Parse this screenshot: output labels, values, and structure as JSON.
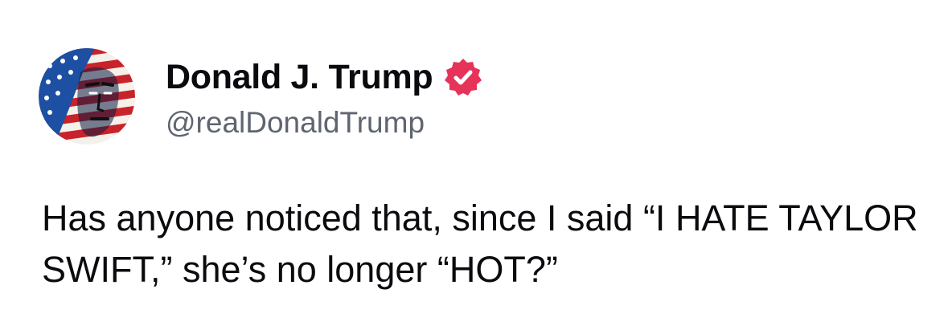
{
  "post": {
    "author": {
      "display_name": "Donald J. Trump",
      "handle": "@realDonaldTrump",
      "verified": true,
      "avatar_icon": "flag-portrait-avatar"
    },
    "body": "Has anyone noticed that, since I said “I HATE TAYLOR SWIFT,” she’s no longer “HOT?”"
  },
  "colors": {
    "verified_badge": "#e6335a",
    "handle": "#5f6570",
    "text": "#0b0b0f",
    "background": "#ffffff"
  }
}
